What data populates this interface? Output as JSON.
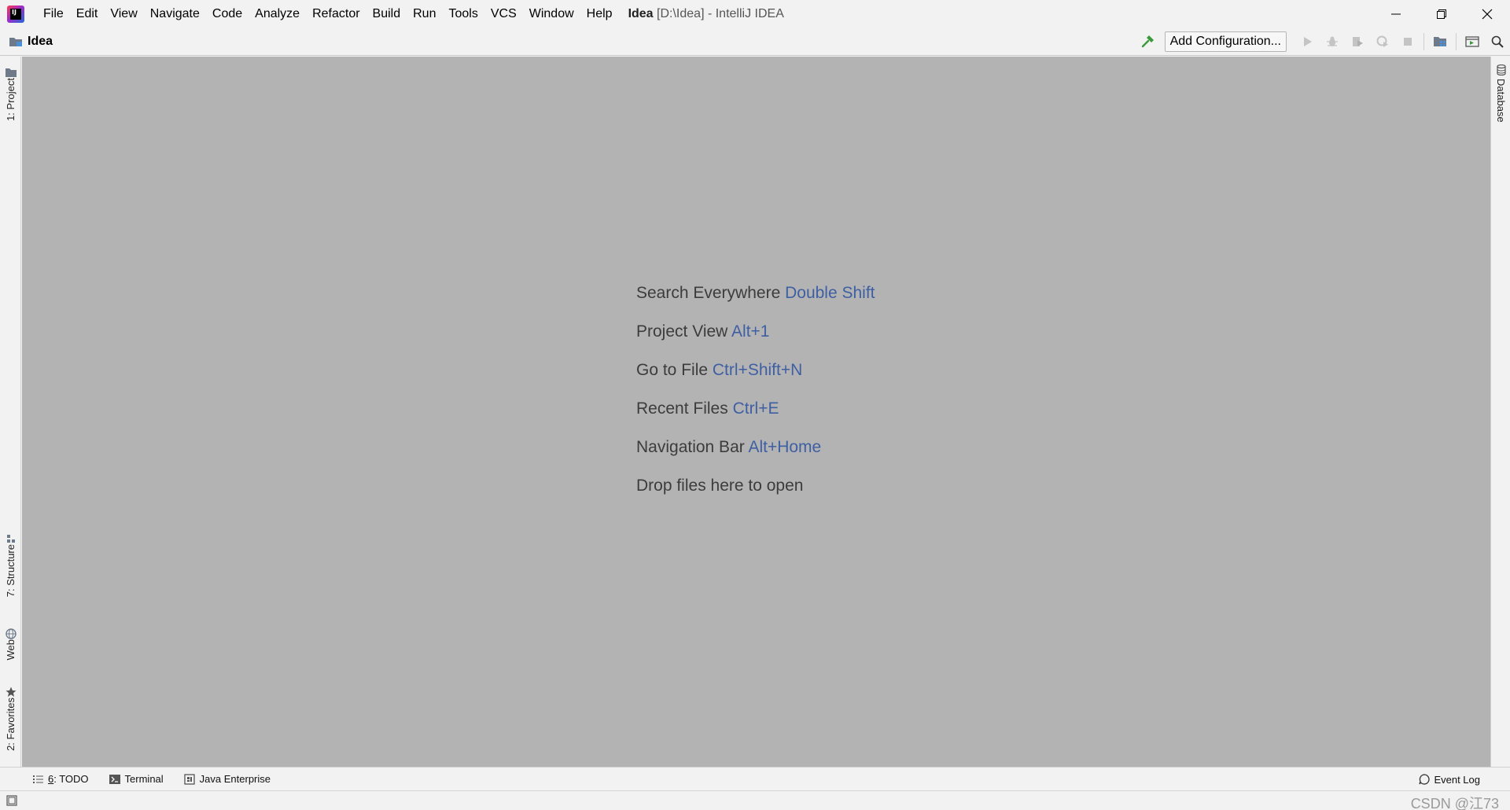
{
  "menu": {
    "items": [
      "File",
      "Edit",
      "View",
      "Navigate",
      "Code",
      "Analyze",
      "Refactor",
      "Build",
      "Run",
      "Tools",
      "VCS",
      "Window",
      "Help"
    ]
  },
  "window": {
    "project_name": "Idea",
    "title_suffix": "[D:\\Idea] - IntelliJ IDEA"
  },
  "navbar": {
    "breadcrumb": "Idea",
    "add_configuration": "Add Configuration..."
  },
  "left_tabs": {
    "project": "1: Project",
    "structure": "7: Structure",
    "web": "Web",
    "favorites": "2: Favorites"
  },
  "right_tabs": {
    "database": "Database"
  },
  "hints": [
    {
      "label": "Search Everywhere",
      "shortcut": "Double Shift"
    },
    {
      "label": "Project View",
      "shortcut": "Alt+1"
    },
    {
      "label": "Go to File",
      "shortcut": "Ctrl+Shift+N"
    },
    {
      "label": "Recent Files",
      "shortcut": "Ctrl+E"
    },
    {
      "label": "Navigation Bar",
      "shortcut": "Alt+Home"
    },
    {
      "label": "Drop files here to open",
      "shortcut": ""
    }
  ],
  "bottom_tabs": {
    "todo_mnemonic": "6",
    "todo_rest": ": TODO",
    "terminal": "Terminal",
    "java_enterprise": "Java Enterprise",
    "event_log": "Event Log"
  },
  "status": {
    "watermark": "CSDN @江73"
  },
  "colors": {
    "editor_background": "#b3b3b3",
    "shortcut_text": "#3f5fa3",
    "build_icon": "#3a9a3a"
  }
}
